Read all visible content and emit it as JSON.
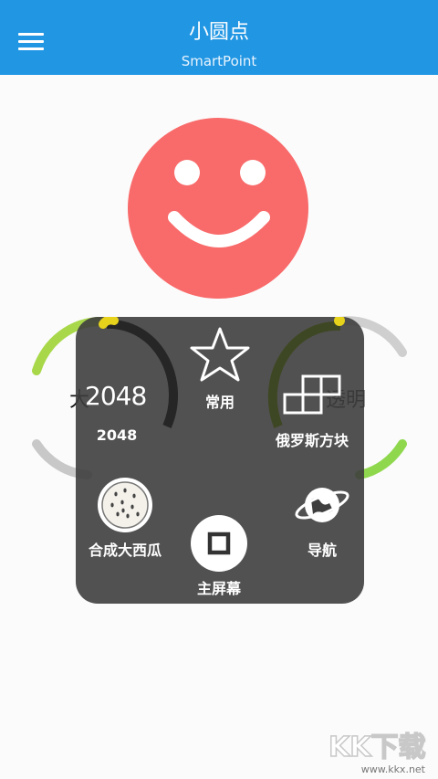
{
  "app": {
    "title": "小圆点",
    "subtitle": "SmartPoint"
  },
  "background": {
    "left_text": "大",
    "right_text": "透明"
  },
  "menu": {
    "item_2048_number": "2048",
    "item_2048_label": "2048",
    "favorites_label": "常用",
    "tetris_label": "俄罗斯方块",
    "watermelon_label": "合成大西瓜",
    "home_label": "主屏幕",
    "navigation_label": "导航"
  },
  "watermark": {
    "logo_text": "KK下载",
    "url": "www.kkx.net"
  },
  "colors": {
    "appbar": "#2196e3",
    "smiley": "#f96a6a",
    "panel": "#3e3e3e",
    "arc_green": "#8fd84e",
    "arc_yellow": "#e7d21c"
  }
}
